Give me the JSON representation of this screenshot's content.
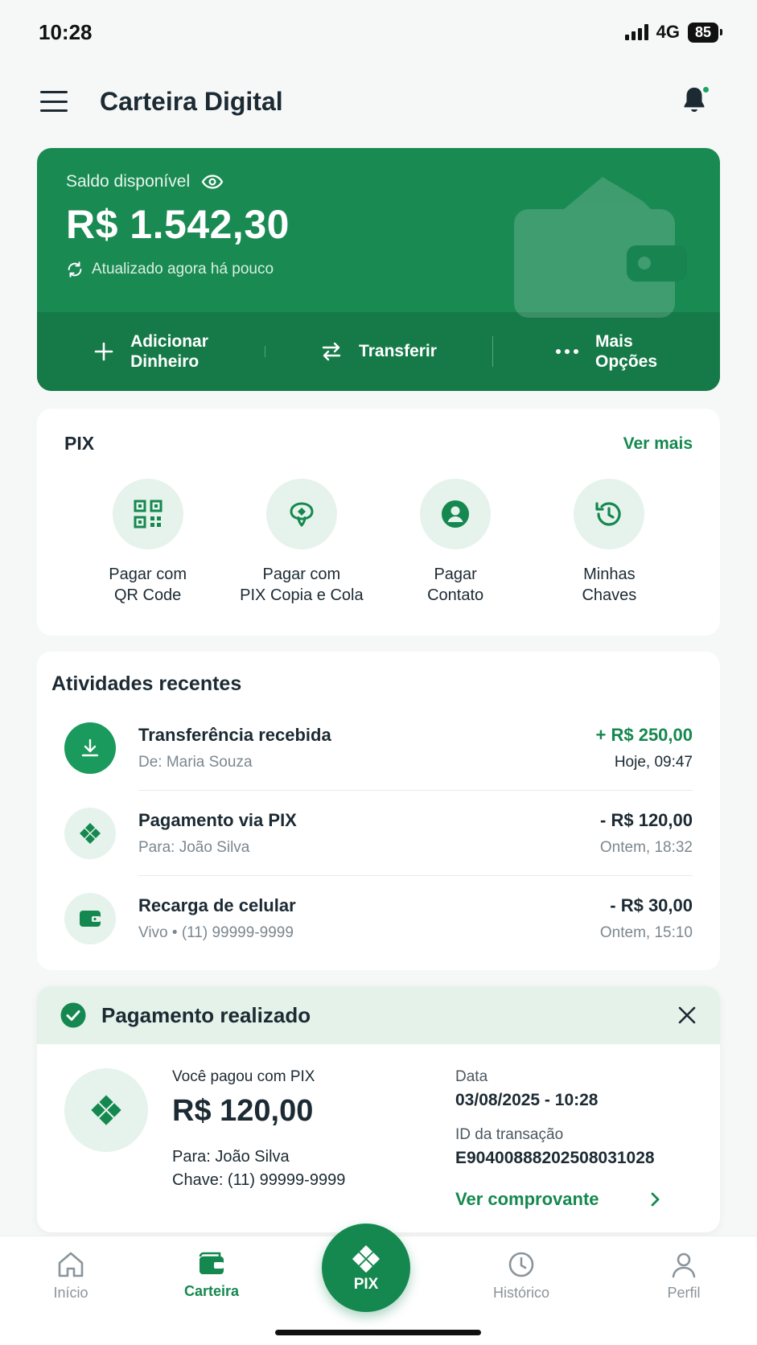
{
  "status": {
    "time": "10:28",
    "network": "4G",
    "battery": "85"
  },
  "header": {
    "title": "Carteira Digital"
  },
  "balance": {
    "label": "Saldo disponível",
    "value": "R$ 1.542,30",
    "updated": "Atualizado agora há pouco",
    "actions": [
      {
        "line1": "Adicionar",
        "line2": "Dinheiro"
      },
      {
        "line1": "Transferir",
        "line2": ""
      },
      {
        "line1": "Mais",
        "line2": "Opções"
      }
    ]
  },
  "pix": {
    "title": "PIX",
    "see_more": "Ver mais",
    "items": [
      {
        "line1": "Pagar com",
        "line2": "QR Code",
        "icon": "qr-code-icon"
      },
      {
        "line1": "Pagar com",
        "line2": "PIX Copia e Cola",
        "icon": "copy-paste-icon"
      },
      {
        "line1": "Pagar",
        "line2": "Contato",
        "icon": "contact-icon"
      },
      {
        "line1": "Minhas",
        "line2": "Chaves",
        "icon": "history-icon"
      }
    ]
  },
  "activities": {
    "title": "Atividades recentes",
    "items": [
      {
        "name": "Transferência recebida",
        "sub": "De: Maria Souza",
        "amount": "+ R$ 250,00",
        "time": "Hoje, 09:47"
      },
      {
        "name": "Pagamento via PIX",
        "sub": "Para: João Silva",
        "amount": "- R$ 120,00",
        "time": "Ontem, 18:32"
      },
      {
        "name": "Recarga de celular",
        "sub": "Vivo • (11) 99999-9999",
        "amount": "- R$ 30,00",
        "time": "Ontem, 15:10"
      }
    ]
  },
  "toast": {
    "title": "Pagamento realizado",
    "paid_with": "Você pagou com PIX",
    "amount": "R$ 120,00",
    "to": "Para: João Silva",
    "key": "Chave: (11) 99999-9999",
    "date_label": "Data",
    "date_value": "03/08/2025 - 10:28",
    "id_label": "ID da transação",
    "id_value": "E90400888202508031028",
    "receipt": "Ver comprovante"
  },
  "nav": {
    "items": [
      {
        "label": "Início"
      },
      {
        "label": "Carteira"
      },
      {
        "label": "PIX"
      },
      {
        "label": "Histórico"
      },
      {
        "label": "Perfil"
      }
    ]
  },
  "colors": {
    "brand": "#1a8a53",
    "brand_dark": "#157a48",
    "accent": "#15884f",
    "soft": "#e6f3ec"
  }
}
